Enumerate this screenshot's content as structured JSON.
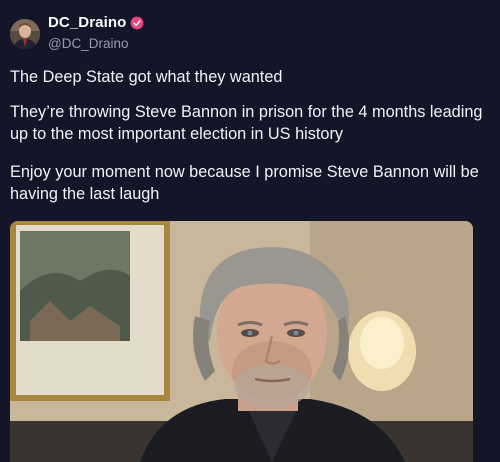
{
  "author": {
    "display_name": "DC_Draino",
    "handle": "@DC_Draino",
    "verified_badge_icon": "verified-badge-icon"
  },
  "post": {
    "paragraphs": [
      "The Deep State got what they wanted",
      "They’re throwing Steve Bannon in prison for the 4 months leading up to the most important election in US history",
      "Enjoy your moment now because I promise Steve Bannon will be having the last laugh"
    ]
  },
  "colors": {
    "background": "#15152a",
    "text": "#f2f2f5",
    "handle": "#9a9aac",
    "verified_badge": "#e8467a"
  }
}
